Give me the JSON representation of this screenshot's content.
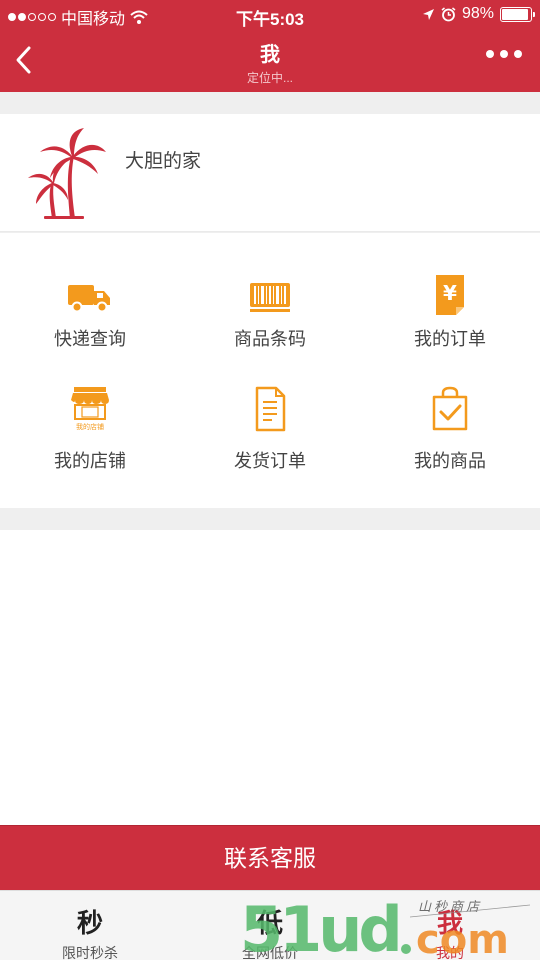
{
  "status_bar": {
    "carrier": "中国移动",
    "time": "下午5:03",
    "battery_text": "98%",
    "battery_level": 0.98,
    "signal_bars": 2,
    "icons": [
      "wifi-icon",
      "location-arrow-icon",
      "alarm-icon",
      "battery-icon"
    ]
  },
  "nav": {
    "title": "我",
    "subtitle": "定位中...",
    "icons": [
      "back-chevron-icon",
      "more-dots-icon"
    ]
  },
  "profile": {
    "name": "大胆的家",
    "avatar_icon": "palm-tree-icon"
  },
  "menu": {
    "items": [
      {
        "label": "快递查询",
        "icon": "delivery-truck-icon"
      },
      {
        "label": "商品条码",
        "icon": "barcode-icon"
      },
      {
        "label": "我的订单",
        "icon": "yuan-order-icon"
      },
      {
        "label": "我的店铺",
        "icon": "storefront-icon",
        "icon_caption": "我的店铺"
      },
      {
        "label": "发货订单",
        "icon": "document-icon"
      },
      {
        "label": "我的商品",
        "icon": "shopping-bag-check-icon"
      }
    ]
  },
  "service_button": {
    "label": "联系客服"
  },
  "tabbar": {
    "tabs": [
      {
        "glyph": "秒",
        "label": "限时秒杀",
        "active": false
      },
      {
        "glyph": "低",
        "label": "全网低价",
        "active": false
      },
      {
        "glyph": "我",
        "label": "我的",
        "active": true
      }
    ]
  },
  "watermark": {
    "text": "51ud.com",
    "sub_text": "山秒商店"
  },
  "colors": {
    "brand_red": "#cc2f3e",
    "icon_orange": "#f39a1d",
    "background_gray": "#efefef",
    "watermark_green": "#55b96b",
    "watermark_orange": "#f08a24"
  }
}
